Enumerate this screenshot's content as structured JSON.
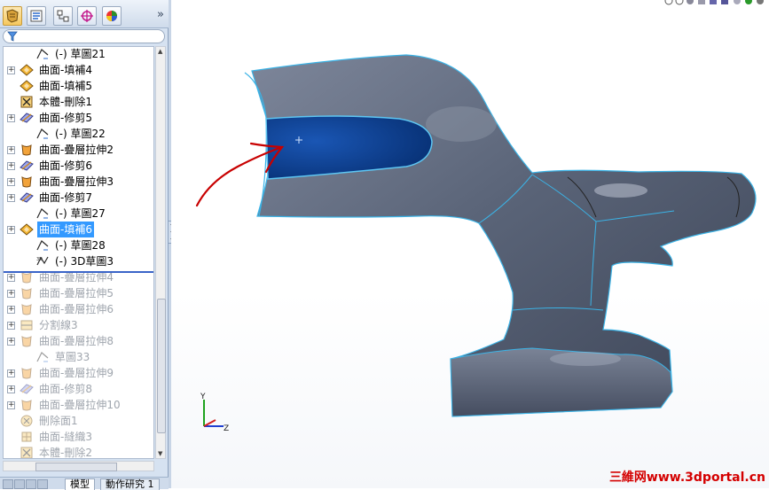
{
  "panel": {
    "toolbar_icons": [
      "feature-manager-icon",
      "property-manager-icon",
      "configuration-manager-icon",
      "dimxpert-icon",
      "display-manager-icon"
    ],
    "collapse_glyph": "»",
    "filter_icon": "funnel-icon"
  },
  "tree": {
    "items": [
      {
        "label": "(-) 草圖21",
        "icon": "sketch-icon",
        "indent": 2,
        "expand": false,
        "suppressed": false
      },
      {
        "label": "曲面-填補4",
        "icon": "fill-surface-icon",
        "indent": 1,
        "expand": true,
        "suppressed": false
      },
      {
        "label": "曲面-填補5",
        "icon": "fill-surface-icon",
        "indent": 1,
        "expand": false,
        "suppressed": false
      },
      {
        "label": "本體-刪除1",
        "icon": "delete-body-icon",
        "indent": 1,
        "expand": false,
        "suppressed": false
      },
      {
        "label": "曲面-修剪5",
        "icon": "trim-surface-icon",
        "indent": 1,
        "expand": true,
        "suppressed": false
      },
      {
        "label": "(-) 草圖22",
        "icon": "sketch-icon",
        "indent": 2,
        "expand": false,
        "suppressed": false
      },
      {
        "label": "曲面-疊層拉伸2",
        "icon": "loft-surface-icon",
        "indent": 1,
        "expand": true,
        "suppressed": false
      },
      {
        "label": "曲面-修剪6",
        "icon": "trim-surface-icon",
        "indent": 1,
        "expand": true,
        "suppressed": false
      },
      {
        "label": "曲面-疊層拉伸3",
        "icon": "loft-surface-icon",
        "indent": 1,
        "expand": true,
        "suppressed": false
      },
      {
        "label": "曲面-修剪7",
        "icon": "trim-surface-icon",
        "indent": 1,
        "expand": true,
        "suppressed": false
      },
      {
        "label": "(-) 草圖27",
        "icon": "sketch-icon",
        "indent": 2,
        "expand": false,
        "suppressed": false
      },
      {
        "label": "曲面-填補6",
        "icon": "fill-surface-icon",
        "indent": 1,
        "expand": true,
        "suppressed": false,
        "selected": true
      },
      {
        "label": "(-) 草圖28",
        "icon": "sketch-icon",
        "indent": 2,
        "expand": false,
        "suppressed": false
      },
      {
        "label": "(-) 3D草圖3",
        "icon": "3d-sketch-icon",
        "indent": 2,
        "expand": false,
        "suppressed": false
      },
      {
        "label": "曲面-疊層拉伸4",
        "icon": "loft-surface-icon",
        "indent": 1,
        "expand": true,
        "suppressed": true
      },
      {
        "label": "曲面-疊層拉伸5",
        "icon": "loft-surface-icon",
        "indent": 1,
        "expand": true,
        "suppressed": true
      },
      {
        "label": "曲面-疊層拉伸6",
        "icon": "loft-surface-icon",
        "indent": 1,
        "expand": true,
        "suppressed": true
      },
      {
        "label": "分割線3",
        "icon": "split-line-icon",
        "indent": 1,
        "expand": true,
        "suppressed": true
      },
      {
        "label": "曲面-疊層拉伸8",
        "icon": "loft-surface-icon",
        "indent": 1,
        "expand": true,
        "suppressed": true
      },
      {
        "label": "草圖33",
        "icon": "sketch-icon",
        "indent": 2,
        "expand": false,
        "suppressed": true
      },
      {
        "label": "曲面-疊層拉伸9",
        "icon": "loft-surface-icon",
        "indent": 1,
        "expand": true,
        "suppressed": true
      },
      {
        "label": "曲面-修剪8",
        "icon": "trim-surface-icon",
        "indent": 1,
        "expand": true,
        "suppressed": true
      },
      {
        "label": "曲面-疊層拉伸10",
        "icon": "loft-surface-icon",
        "indent": 1,
        "expand": true,
        "suppressed": true
      },
      {
        "label": "刪除面1",
        "icon": "delete-face-icon",
        "indent": 1,
        "expand": false,
        "suppressed": true
      },
      {
        "label": "曲面-縫織3",
        "icon": "knit-surface-icon",
        "indent": 1,
        "expand": false,
        "suppressed": true
      },
      {
        "label": "本體-刪除2",
        "icon": "delete-body-icon",
        "indent": 1,
        "expand": false,
        "suppressed": true
      }
    ]
  },
  "tabs": [
    {
      "label": "模型",
      "active": true
    },
    {
      "label": "動作研究 1",
      "active": false
    }
  ],
  "viewport": {
    "triad_labels": {
      "y": "Y",
      "z": "Z"
    },
    "model_color": "#5a6478",
    "selected_face_color": "#0a3d8f",
    "annotation_color": "#c00000",
    "heads_up_icons": [
      "zoom-to-fit-icon",
      "zoom-area-icon",
      "previous-view-icon",
      "section-view-icon",
      "view-orientation-icon",
      "display-style-icon",
      "hide-show-icon",
      "appearance-icon",
      "scene-icon"
    ]
  },
  "watermark": "三維网www.3dportal.cn"
}
